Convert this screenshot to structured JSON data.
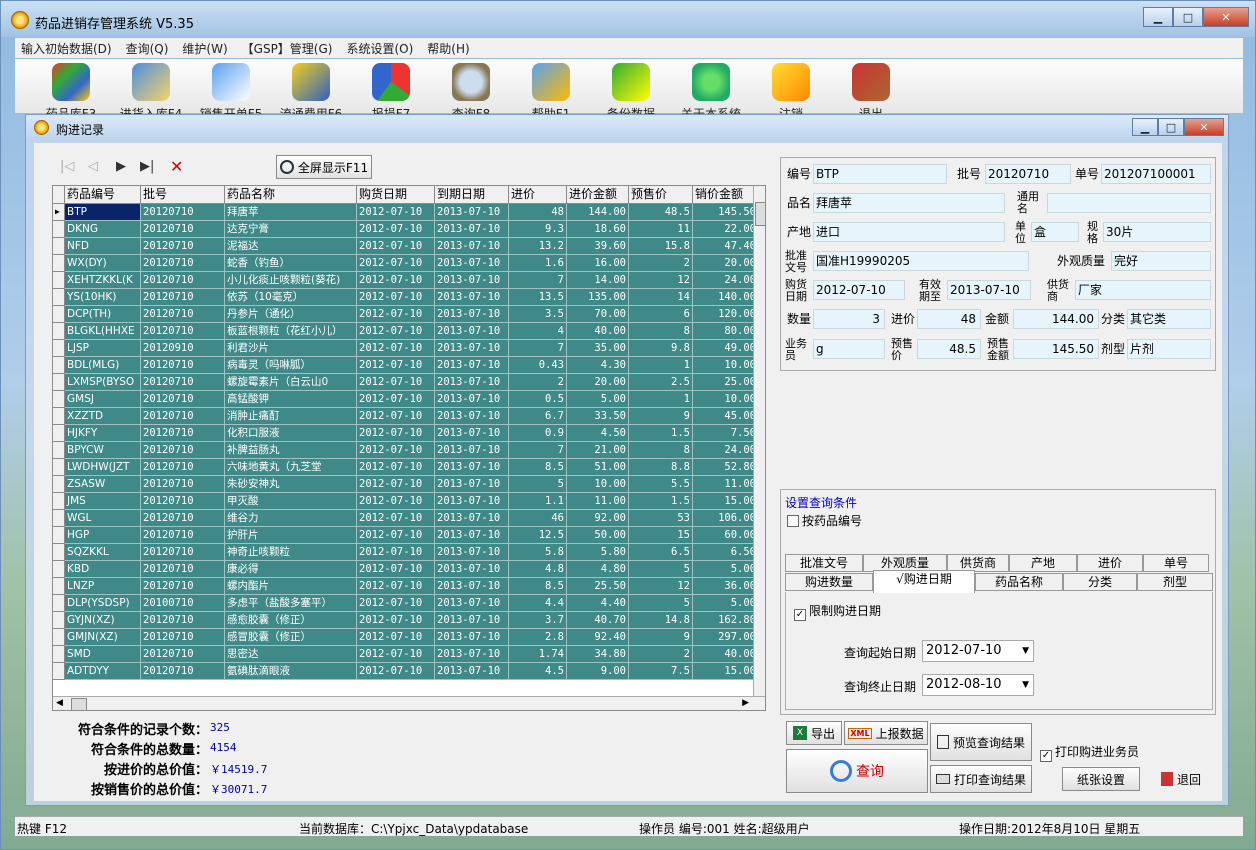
{
  "app": {
    "title": "药品进销存管理系统 V5.35"
  },
  "menu": [
    "输入初始数据(D)",
    "查询(Q)",
    "维护(W)",
    "【GSP】管理(G)",
    "系统设置(O)",
    "帮助(H)"
  ],
  "toolbar": [
    {
      "label": "药品库F3",
      "icon": "windows-icon"
    },
    {
      "label": "进货入库F4",
      "icon": "house-icon"
    },
    {
      "label": "销售开单F5",
      "icon": "sales-icon"
    },
    {
      "label": "流通费用F6",
      "icon": "car-icon"
    },
    {
      "label": "报损F7",
      "icon": "piechart-icon"
    },
    {
      "label": "查询F8",
      "icon": "magnifier-icon"
    },
    {
      "label": "帮助F1",
      "icon": "help-icon"
    },
    {
      "label": "备份数据",
      "icon": "database-icon"
    },
    {
      "label": "关于本系统",
      "icon": "about-icon"
    },
    {
      "label": "注销",
      "icon": "key-icon"
    },
    {
      "label": "退出",
      "icon": "exit-icon"
    }
  ],
  "child": {
    "title": "购进记录"
  },
  "grid_buttons": {
    "fullscreen": "全屏显示F11",
    "nav_first": "|◁",
    "nav_prev": "◁",
    "nav_next": "▶",
    "nav_last": "▶|",
    "delete": "✕"
  },
  "grid": {
    "columns": [
      "药品编号",
      "批号",
      "药品名称",
      "购货日期",
      "到期日期",
      "进价",
      "进价金额",
      "预售价",
      "销价金额"
    ],
    "rows": [
      [
        "BTP",
        "20120710",
        "拜唐苹",
        "2012-07-10",
        "2013-07-10",
        "48",
        "144.00",
        "48.5",
        "145.50"
      ],
      [
        "DKNG",
        "20120710",
        "达克宁膏",
        "2012-07-10",
        "2013-07-10",
        "9.3",
        "18.60",
        "11",
        "22.00"
      ],
      [
        "NFD",
        "20120710",
        "泥福达",
        "2012-07-10",
        "2013-07-10",
        "13.2",
        "39.60",
        "15.8",
        "47.40"
      ],
      [
        "WX(DY)",
        "20120710",
        "蛇香（钓鱼）",
        "2012-07-10",
        "2013-07-10",
        "1.6",
        "16.00",
        "2",
        "20.00"
      ],
      [
        "XEHTZKKL(K",
        "20120710",
        "小儿化痰止咳颗粒(葵花)",
        "2012-07-10",
        "2013-07-10",
        "7",
        "14.00",
        "12",
        "24.00"
      ],
      [
        "YS(10HK)",
        "20120710",
        "依苏（10毫克）",
        "2012-07-10",
        "2013-07-10",
        "13.5",
        "135.00",
        "14",
        "140.00"
      ],
      [
        "DCP(TH)",
        "20120710",
        "丹参片（通化）",
        "2012-07-10",
        "2013-07-10",
        "3.5",
        "70.00",
        "6",
        "120.00"
      ],
      [
        "BLGKL(HHXE",
        "20120710",
        "板蓝根颗粒（花红小儿）",
        "2012-07-10",
        "2013-07-10",
        "4",
        "40.00",
        "8",
        "80.00"
      ],
      [
        "LJSP",
        "20120910",
        "利君沙片",
        "2012-07-10",
        "2013-07-10",
        "7",
        "35.00",
        "9.8",
        "49.00"
      ],
      [
        "BDL(MLG)",
        "20120710",
        "病毒灵（吗啉胍）",
        "2012-07-10",
        "2013-07-10",
        "0.43",
        "4.30",
        "1",
        "10.00"
      ],
      [
        "LXMSP(BYSO",
        "20120710",
        "螺旋霉素片（白云山0",
        "2012-07-10",
        "2013-07-10",
        "2",
        "20.00",
        "2.5",
        "25.00"
      ],
      [
        "GMSJ",
        "20120710",
        "高锰酸钾",
        "2012-07-10",
        "2013-07-10",
        "0.5",
        "5.00",
        "1",
        "10.00"
      ],
      [
        "XZZTD",
        "20120710",
        "消肿止痛酊",
        "2012-07-10",
        "2013-07-10",
        "6.7",
        "33.50",
        "9",
        "45.00"
      ],
      [
        "HJKFY",
        "20120710",
        "化积口服液",
        "2012-07-10",
        "2013-07-10",
        "0.9",
        "4.50",
        "1.5",
        "7.50"
      ],
      [
        "BPYCW",
        "20120710",
        "补脾益肠丸",
        "2012-07-10",
        "2013-07-10",
        "7",
        "21.00",
        "8",
        "24.00"
      ],
      [
        "LWDHW(JZT",
        "20120710",
        "六味地黄丸（九芝堂",
        "2012-07-10",
        "2013-07-10",
        "8.5",
        "51.00",
        "8.8",
        "52.80"
      ],
      [
        "ZSASW",
        "20120710",
        "朱砂安神丸",
        "2012-07-10",
        "2013-07-10",
        "5",
        "10.00",
        "5.5",
        "11.00"
      ],
      [
        "JMS",
        "20120710",
        "甲灭酸",
        "2012-07-10",
        "2013-07-10",
        "1.1",
        "11.00",
        "1.5",
        "15.00"
      ],
      [
        "WGL",
        "20120710",
        "维谷力",
        "2012-07-10",
        "2013-07-10",
        "46",
        "92.00",
        "53",
        "106.00"
      ],
      [
        "HGP",
        "20120710",
        "护肝片",
        "2012-07-10",
        "2013-07-10",
        "12.5",
        "50.00",
        "15",
        "60.00"
      ],
      [
        "SQZKKL",
        "20120710",
        "神奇止咳颗粒",
        "2012-07-10",
        "2013-07-10",
        "5.8",
        "5.80",
        "6.5",
        "6.50"
      ],
      [
        "KBD",
        "20120710",
        "康必得",
        "2012-07-10",
        "2013-07-10",
        "4.8",
        "4.80",
        "5",
        "5.00"
      ],
      [
        "LNZP",
        "20120710",
        "螺内酯片",
        "2012-07-10",
        "2013-07-10",
        "8.5",
        "25.50",
        "12",
        "36.00"
      ],
      [
        "DLP(YSDSP)",
        "20100710",
        "多虑平（盐酸多塞平）",
        "2012-07-10",
        "2013-07-10",
        "4.4",
        "4.40",
        "5",
        "5.00"
      ],
      [
        "GYJN(XZ)",
        "20120710",
        "感愈胶囊（修正）",
        "2012-07-10",
        "2013-07-10",
        "3.7",
        "40.70",
        "14.8",
        "162.80"
      ],
      [
        "GMJN(XZ)",
        "20120710",
        "感冒胶囊（修正）",
        "2012-07-10",
        "2013-07-10",
        "2.8",
        "92.40",
        "9",
        "297.00"
      ],
      [
        "SMD",
        "20120710",
        "思密达",
        "2012-07-10",
        "2013-07-10",
        "1.74",
        "34.80",
        "2",
        "40.00"
      ],
      [
        "ADTDYY",
        "20120710",
        "氨碘肽滴眼液",
        "2012-07-10",
        "2013-07-10",
        "4.5",
        "9.00",
        "7.5",
        "15.00"
      ]
    ]
  },
  "summary": {
    "count_label": "符合条件的记录个数：",
    "count": "325",
    "qty_label": "符合条件的总数量：",
    "qty": "4154",
    "cost_label": "按进价的总价值：",
    "cost": "￥14519.7",
    "sale_label": "按销售价的总价值：",
    "sale": "￥30071.7"
  },
  "detail": {
    "code_label": "编号",
    "code": "BTP",
    "batch_label": "批号",
    "batch": "20120710",
    "doc_label": "单号",
    "doc": "201207100001",
    "name_label": "品名",
    "name": "拜唐苹",
    "generic_label": "通用名",
    "generic": "",
    "origin_label": "产地",
    "origin": "进口",
    "unit_label": "单位",
    "unit": "盒",
    "spec_label": "规格",
    "spec": "30片",
    "approval_label": "批准文号",
    "approval": "国准H19990205",
    "quality_label": "外观质量",
    "quality": "完好",
    "buydate_label": "购货日期",
    "buydate": "2012-07-10",
    "expiry_label": "有效期至",
    "expiry": "2013-07-10",
    "supplier_label": "供货商",
    "supplier": "厂家",
    "qty_label": "数量",
    "qty": "3",
    "price_label": "进价",
    "price": "48",
    "amount_label": "金额",
    "amount": "144.00",
    "category_label": "分类",
    "category": "其它类",
    "staff_label": "业务员",
    "staff": "g",
    "presale_label": "预售价",
    "presale": "48.5",
    "saleamt_label": "预售金额",
    "saleamt": "145.50",
    "form_label": "剂型",
    "form": "片剂"
  },
  "query": {
    "title": "设置查询条件",
    "by_code": "按药品编号",
    "tabs_row1": [
      "批准文号",
      "外观质量",
      "供货商",
      "产地",
      "进价",
      "单号"
    ],
    "tabs_row2": [
      "购进数量",
      "√购进日期",
      "药品名称",
      "分类",
      "剂型"
    ],
    "limit_date": "限制购进日期",
    "start_label": "查询起始日期",
    "start": "2012-07-10",
    "end_label": "查询终止日期",
    "end": "2012-08-10"
  },
  "buttons": {
    "export": "导出",
    "upload": "上报数据",
    "preview": "预览查询结果",
    "print_staff": "打印购进业务员",
    "search": "查询",
    "print": "打印查询结果",
    "paper": "纸张设置",
    "back": "退回"
  },
  "status": {
    "hotkey": "热键 F12",
    "db": "当前数据库：C:\\Ypjxc_Data\\ypdatabase",
    "operator": "操作员 编号:001  姓名:超级用户",
    "date": "操作日期:2012年8月10日 星期五"
  }
}
